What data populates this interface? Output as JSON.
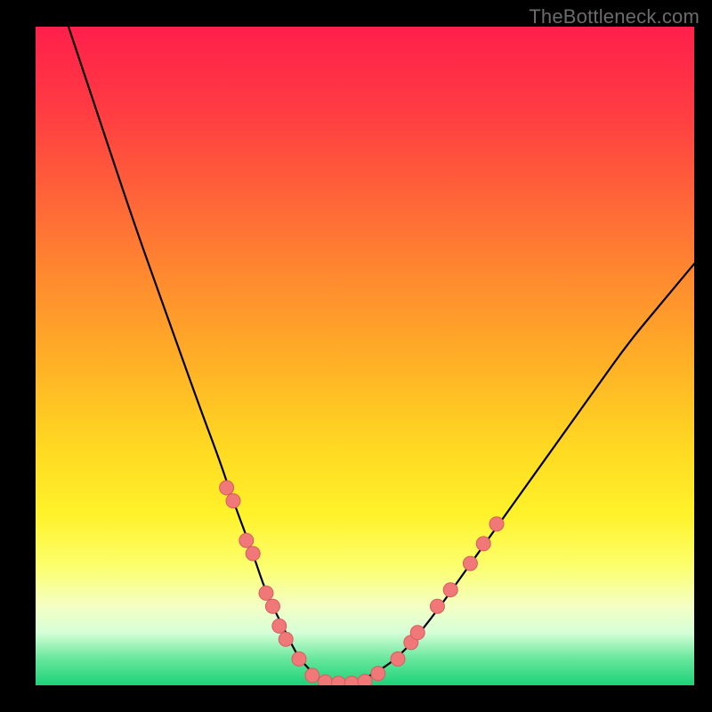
{
  "watermark": "TheBottleneck.com",
  "chart_data": {
    "type": "line",
    "title": "",
    "xlabel": "",
    "ylabel": "",
    "xlim": [
      0,
      100
    ],
    "ylim": [
      0,
      100
    ],
    "grid": false,
    "legend": false,
    "background_gradient": {
      "top": "#ff1f4b",
      "mid": "#fff22a",
      "bottom": "#1dd27a"
    },
    "series": [
      {
        "name": "bottleneck-curve",
        "x": [
          5,
          10,
          15,
          20,
          25,
          28,
          30,
          33,
          35,
          38,
          40,
          43,
          45,
          48,
          50,
          55,
          60,
          65,
          70,
          75,
          80,
          85,
          90,
          95,
          100
        ],
        "y": [
          100,
          85,
          70,
          56,
          42,
          34,
          28,
          20,
          14,
          8,
          4,
          1,
          0,
          0,
          1,
          4,
          10,
          17,
          24,
          31,
          38,
          45,
          52,
          58,
          64
        ]
      }
    ],
    "markers": {
      "name": "highlight-dots",
      "color": "#f07878",
      "points": [
        {
          "x": 29,
          "y": 30
        },
        {
          "x": 30,
          "y": 28
        },
        {
          "x": 32,
          "y": 22
        },
        {
          "x": 33,
          "y": 20
        },
        {
          "x": 35,
          "y": 14
        },
        {
          "x": 36,
          "y": 12
        },
        {
          "x": 37,
          "y": 9
        },
        {
          "x": 38,
          "y": 7
        },
        {
          "x": 40,
          "y": 4
        },
        {
          "x": 42,
          "y": 1.5
        },
        {
          "x": 44,
          "y": 0.5
        },
        {
          "x": 46,
          "y": 0.3
        },
        {
          "x": 48,
          "y": 0.3
        },
        {
          "x": 50,
          "y": 0.6
        },
        {
          "x": 52,
          "y": 1.8
        },
        {
          "x": 55,
          "y": 4
        },
        {
          "x": 57,
          "y": 6.5
        },
        {
          "x": 58,
          "y": 8
        },
        {
          "x": 61,
          "y": 12
        },
        {
          "x": 63,
          "y": 14.5
        },
        {
          "x": 66,
          "y": 18.5
        },
        {
          "x": 68,
          "y": 21.5
        },
        {
          "x": 70,
          "y": 24.5
        }
      ]
    }
  }
}
